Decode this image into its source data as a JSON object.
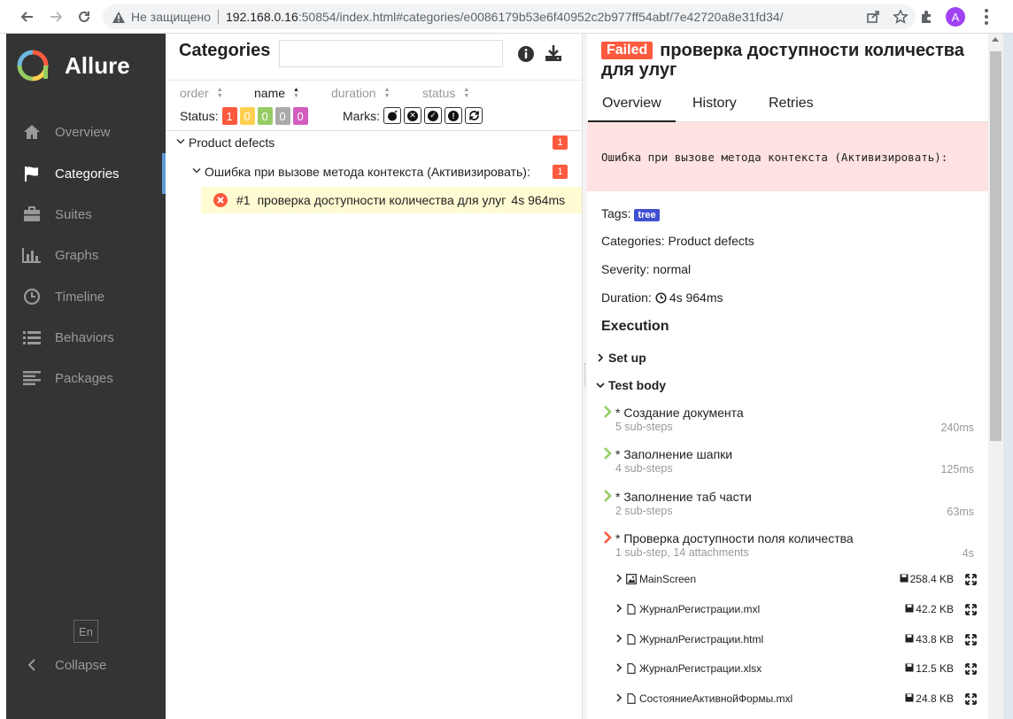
{
  "browser": {
    "insecure_label": "Не защищено",
    "url_host": "192.168.0.16",
    "url_port_path": ":50854/index.html#categories/e0086179b53e6f40952c2b977ff54abf/7e42720a8e31fd34/",
    "avatar_letter": "A"
  },
  "sidebar": {
    "brand": "Allure",
    "items": [
      {
        "label": "Overview",
        "icon": "home-icon"
      },
      {
        "label": "Categories",
        "icon": "flag-icon"
      },
      {
        "label": "Suites",
        "icon": "briefcase-icon"
      },
      {
        "label": "Graphs",
        "icon": "bar-chart-icon"
      },
      {
        "label": "Timeline",
        "icon": "clock-icon"
      },
      {
        "label": "Behaviors",
        "icon": "list-icon"
      },
      {
        "label": "Packages",
        "icon": "align-left-icon"
      }
    ],
    "active_index": 1,
    "lang": "En",
    "collapse": "Collapse"
  },
  "categories": {
    "title": "Categories",
    "search_value": "",
    "sort": [
      "order",
      "name",
      "duration",
      "status"
    ],
    "status_label": "Status:",
    "status_counts": [
      {
        "value": "1",
        "color": "#fd5a3e"
      },
      {
        "value": "0",
        "color": "#ffd050"
      },
      {
        "value": "0",
        "color": "#97cc64"
      },
      {
        "value": "0",
        "color": "#aaaaaa"
      },
      {
        "value": "0",
        "color": "#d35ebe"
      }
    ],
    "marks_label": "Marks:",
    "group": {
      "name": "Product defects",
      "count": "1"
    },
    "subgroup": {
      "name": "Ошибка при вызове метода контекста (Активизировать):",
      "count": "1"
    },
    "test": {
      "num": "#1",
      "name": "проверка доступности количества для улуг",
      "duration": "4s 964ms"
    }
  },
  "detail": {
    "status": "Failed",
    "title": "проверка доступности количества для улуг",
    "tabs": [
      "Overview",
      "History",
      "Retries"
    ],
    "error": "Ошибка при вызове метода контекста (Активизировать):",
    "tags_label": "Tags:",
    "tag": "tree",
    "categories_line": "Categories: Product defects",
    "severity_line": "Severity: normal",
    "duration_label": "Duration:",
    "duration": "4s 964ms",
    "execution": "Execution",
    "setup": "Set up",
    "testbody": "Test body",
    "steps": [
      {
        "name": "* Создание документа",
        "sub": "5 sub-steps",
        "dur": "240ms",
        "status": "passed"
      },
      {
        "name": "* Заполнение шапки",
        "sub": "4 sub-steps",
        "dur": "125ms",
        "status": "passed"
      },
      {
        "name": "* Заполнение таб части",
        "sub": "2 sub-steps",
        "dur": "63ms",
        "status": "passed"
      },
      {
        "name": "* Проверка доступности поля количества",
        "sub": "1 sub-step, 14 attachments",
        "dur": "4s",
        "status": "failed"
      }
    ],
    "attachments": [
      {
        "name": "MainScreen",
        "size": "258.4 KB",
        "icon": "image-icon"
      },
      {
        "name": "ЖурналРегистрации.mxl",
        "size": "42.2 KB",
        "icon": "file-icon"
      },
      {
        "name": "ЖурналРегистрации.html",
        "size": "43.8 KB",
        "icon": "file-icon"
      },
      {
        "name": "ЖурналРегистрации.xlsx",
        "size": "12.5 KB",
        "icon": "file-icon"
      },
      {
        "name": "СостояниеАктивнойФормы.mxl",
        "size": "24.8 KB",
        "icon": "file-icon"
      }
    ]
  }
}
